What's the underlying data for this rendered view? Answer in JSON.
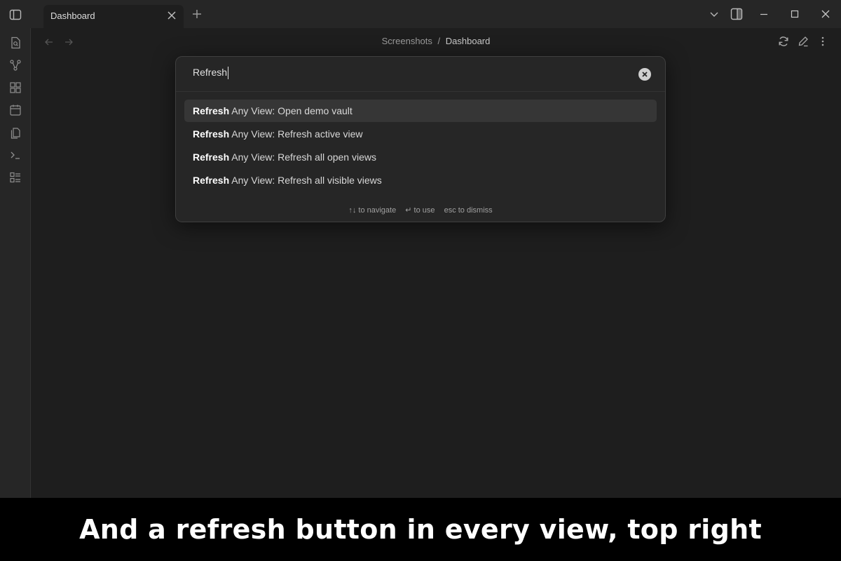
{
  "titlebar": {
    "tab_title": "Dashboard",
    "sidebar_toggle_icon": "sidebar-toggle-icon",
    "window_controls": [
      "chevron-down-icon",
      "right-sidebar-icon",
      "minimize-icon",
      "maximize-icon",
      "close-icon"
    ]
  },
  "ribbon": {
    "icons": [
      "file-search-icon",
      "graph-icon",
      "canvas-icon",
      "calendar-icon",
      "copy-icon",
      "terminal-icon",
      "list-icon"
    ]
  },
  "header": {
    "breadcrumb_parent": "Screenshots",
    "breadcrumb_separator": "/",
    "breadcrumb_current": "Dashboard",
    "actions": [
      "refresh-icon",
      "edit-icon",
      "more-icon"
    ]
  },
  "palette": {
    "query": "Refresh",
    "results": [
      {
        "match": "Refresh",
        "rest": " Any View: Open demo vault"
      },
      {
        "match": "Refresh",
        "rest": " Any View: Refresh active view"
      },
      {
        "match": "Refresh",
        "rest": " Any View: Refresh all open views"
      },
      {
        "match": "Refresh",
        "rest": " Any View: Refresh all visible views"
      }
    ],
    "hints": {
      "navigate": "↑↓ to navigate",
      "use": "↵ to use",
      "dismiss": "esc to dismiss"
    }
  },
  "caption": "And a refresh button in every view, top right",
  "colors": {
    "background": "#1e1e1e",
    "chrome": "#262626",
    "selected_row": "#363636",
    "caption_bg": "#000000"
  }
}
